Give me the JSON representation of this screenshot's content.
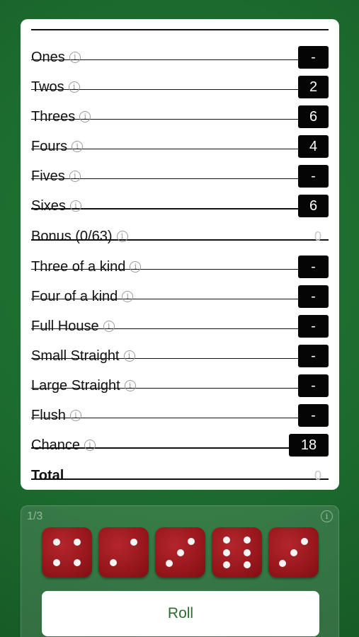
{
  "scorecard": {
    "upper": [
      {
        "label": "Ones",
        "score": "-"
      },
      {
        "label": "Twos",
        "score": "2"
      },
      {
        "label": "Threes",
        "score": "6"
      },
      {
        "label": "Fours",
        "score": "4"
      },
      {
        "label": "Fives",
        "score": "-"
      },
      {
        "label": "Sixes",
        "score": "6"
      }
    ],
    "bonus": {
      "label": "Bonus (0/63)",
      "score": "0"
    },
    "lower": [
      {
        "label": "Three of a kind",
        "score": "-"
      },
      {
        "label": "Four of a kind",
        "score": "-"
      },
      {
        "label": "Full House",
        "score": "-"
      },
      {
        "label": "Small Straight",
        "score": "-"
      },
      {
        "label": "Large Straight",
        "score": "-"
      },
      {
        "label": "Flush",
        "score": "-"
      },
      {
        "label": "Chance",
        "score": "18"
      }
    ],
    "total": {
      "label": "Total",
      "score": "0"
    }
  },
  "info_icon": "info-circle-icon",
  "dice_panel": {
    "roll_count": "1/3",
    "dice": [
      4,
      2,
      3,
      6,
      3
    ],
    "roll_label": "Roll"
  },
  "colors": {
    "felt": "#1f6b2f",
    "die": "#97171c",
    "score_box": "#050505",
    "roll_text": "#2c6b2f"
  }
}
